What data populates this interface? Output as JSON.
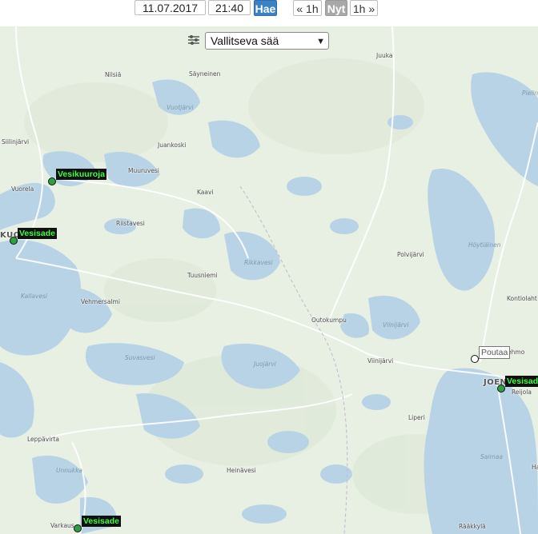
{
  "controls": {
    "date_value": "11.07.2017",
    "time_value": "21:40",
    "fetch_label": "Hae",
    "prev_label": "« 1h",
    "now_label": "Nyt",
    "next_label": "1h »"
  },
  "layer": {
    "selected": "Vallitseva sää"
  },
  "places": {
    "nilsia": "Nilsiä",
    "sayneinen": "Säyneinen",
    "juuka": "Juuka",
    "vuotjarvi": "Vuotjärvi",
    "pielin": "Pielin",
    "siilinjarvi": "Siilinjärvi",
    "juankoski": "Juankoski",
    "muuruvesi": "Muuruvesi",
    "vuorela": "Vuorela",
    "kaavi": "Kaavi",
    "riistavesi": "Riistavesi",
    "kuo": "KUO",
    "hoytiainen": "Höytiäinen",
    "polvijarvi": "Polvijärvi",
    "rikkavesi": "Rikkavesi",
    "tuusniemi": "Tuusniemi",
    "kallavesi": "Kallavesi",
    "vehmersalmi": "Vehmersalmi",
    "kontiolahti": "Kontiolaht",
    "outokumpu": "Outokumpu",
    "viinijarvi_lake": "Viinijärvi",
    "suvasvesi": "Suvasvesi",
    "viinijarvi": "Viinijärvi",
    "juojarvi": "Juojärvi",
    "lehmo": "Lehmo",
    "joen": "JOEN",
    "reijola": "Reijola",
    "liperi": "Liperi",
    "leppavirta": "Leppävirta",
    "saimaa": "Saimaa",
    "unnukka": "Unnukka",
    "heinavesi": "Heinävesi",
    "ha": "Ha",
    "varkaus": "Varkaus",
    "raakkyla": "Rääkkylä"
  },
  "observations": {
    "vesikuuroja": "Vesikuuroja",
    "kuopio": "Vesisade",
    "poutaa": "Poutaa",
    "joensuu": "Vesisade",
    "varkaus": "Vesisade"
  },
  "colors": {
    "land": "#e8efe3",
    "water": "#b9d3e6",
    "road": "#ffffff",
    "rain_label_text": "#3cff3c",
    "rain_marker": "#2ea043",
    "accent_button": "#3b82c4"
  },
  "icons": {
    "filter": "sliders-icon",
    "select_arrow": "chevron-down-icon"
  }
}
